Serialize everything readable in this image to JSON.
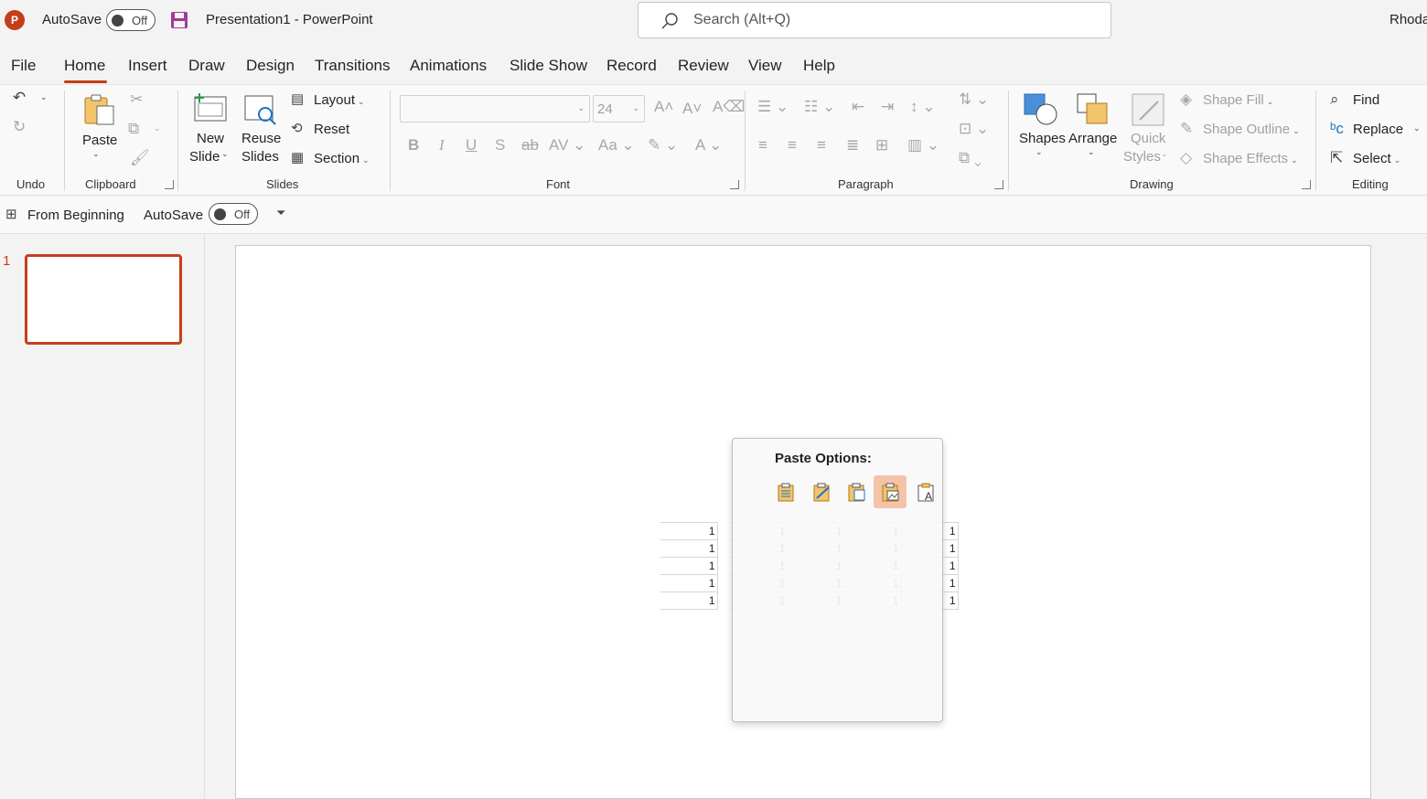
{
  "titlebar": {
    "app_logo": "P",
    "autosave_label": "AutoSave",
    "autosave_state": "Off",
    "document_title": "Presentation1  -  PowerPoint",
    "search_placeholder": "Search (Alt+Q)",
    "user_name": "Rhoda"
  },
  "tabs": [
    "File",
    "Home",
    "Insert",
    "Draw",
    "Design",
    "Transitions",
    "Animations",
    "Slide Show",
    "Record",
    "Review",
    "View",
    "Help"
  ],
  "active_tab": "Home",
  "ribbon": {
    "groups": {
      "undo": "Undo",
      "clipboard": "Clipboard",
      "slides": "Slides",
      "font": "Font",
      "paragraph": "Paragraph",
      "drawing": "Drawing",
      "editing": "Editing"
    },
    "paste": "Paste",
    "new_slide": [
      "New",
      "Slide"
    ],
    "reuse_slides": [
      "Reuse",
      "Slides"
    ],
    "layout": "Layout",
    "reset": "Reset",
    "section": "Section",
    "font_size": "24",
    "shapes": "Shapes",
    "arrange": "Arrange",
    "quick_styles": [
      "Quick",
      "Styles"
    ],
    "shape_fill": "Shape Fill",
    "shape_outline": "Shape Outline",
    "shape_effects": "Shape Effects",
    "find": "Find",
    "replace": "Replace",
    "select": "Select"
  },
  "qat": {
    "from_beginning": "From Beginning",
    "autosave_label": "AutoSave",
    "autosave_state": "Off"
  },
  "thumbnails": {
    "slide_number": "1"
  },
  "paste_popup": {
    "title": "Paste Options:",
    "options": [
      "use-destination-styles-icon",
      "keep-source-formatting-icon",
      "embed-icon",
      "picture-icon",
      "keep-text-only-icon"
    ],
    "selected_index": 3
  },
  "table": {
    "rows": [
      [
        "1",
        "1",
        "1",
        "1",
        "1"
      ],
      [
        "1",
        "1",
        "1",
        "1",
        "1"
      ],
      [
        "1",
        "1",
        "1",
        "1",
        "1"
      ],
      [
        "1",
        "1",
        "1",
        "1",
        "1"
      ],
      [
        "1",
        "1",
        "1",
        "1",
        "1"
      ]
    ]
  },
  "colors": {
    "accent": "#c43e1c",
    "selected_paste_option": "#f4c3a8"
  }
}
